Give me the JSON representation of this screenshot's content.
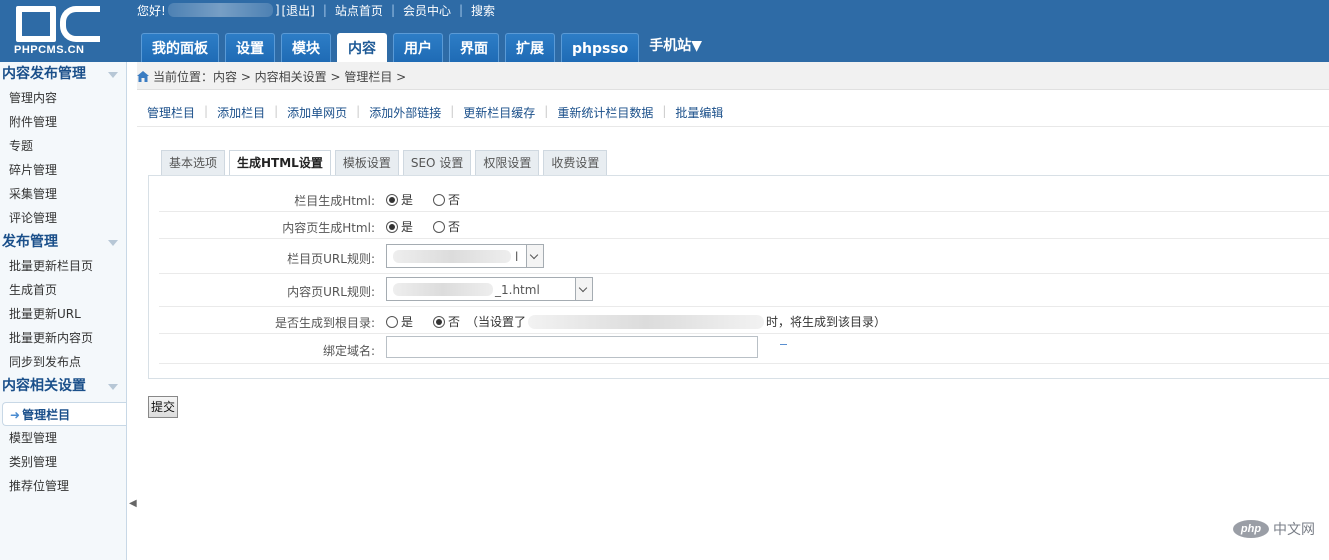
{
  "header": {
    "logo_text": "PHPCMS.CN",
    "greeting": "您好!",
    "greeting_tail": "]",
    "links": [
      "[退出]",
      "站点首页",
      "会员中心",
      "搜索"
    ],
    "tabs": [
      "我的面板",
      "设置",
      "模块",
      "内容",
      "用户",
      "界面",
      "扩展",
      "phpsso"
    ],
    "mobile_label": "手机站▼",
    "active_tab": "内容"
  },
  "sidebar": {
    "sections": [
      {
        "title": "内容发布管理",
        "items": [
          "管理内容",
          "附件管理",
          "专题",
          "碎片管理",
          "采集管理",
          "评论管理"
        ]
      },
      {
        "title": "发布管理",
        "items": [
          "批量更新栏目页",
          "生成首页",
          "批量更新URL",
          "批量更新内容页",
          "同步到发布点"
        ]
      },
      {
        "title": "内容相关设置",
        "items": [
          "管理栏目",
          "模型管理",
          "类别管理",
          "推荐位管理"
        ]
      }
    ],
    "active_item": "管理栏目",
    "collapse_glyph": "◀"
  },
  "breadcrumb": "当前位置：内容 > 内容相关设置 > 管理栏目 >",
  "subnav": [
    "管理栏目",
    "添加栏目",
    "添加单网页",
    "添加外部链接",
    "更新栏目缓存",
    "重新统计栏目数据",
    "批量编辑"
  ],
  "form_tabs": [
    "基本选项",
    "生成HTML设置",
    "模板设置",
    "SEO 设置",
    "权限设置",
    "收费设置"
  ],
  "active_form_tab": "生成HTML设置",
  "form": {
    "ishtml_label": "栏目生成Html:",
    "content_ishtml_label": "内容页生成Html:",
    "yes": "是",
    "no": "否",
    "category_url_label": "栏目页URL规则:",
    "category_url_tail": "l",
    "show_url_label": "内容页URL规则:",
    "show_url_tail": "_1.html",
    "create_root_label": "是否生成到根目录:",
    "create_root_hint_pre": "（当设置了",
    "create_root_hint_post": "时，将生成到该目录）",
    "domain_label": "绑定域名:",
    "domain_value": ""
  },
  "submit_label": "提交",
  "watermark": {
    "badge": "php",
    "text": "中文网"
  }
}
